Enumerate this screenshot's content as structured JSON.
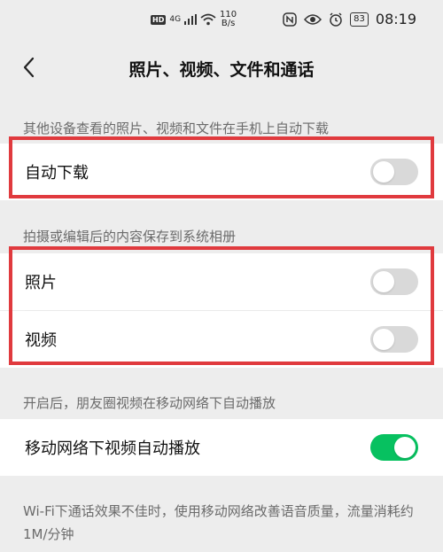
{
  "status_bar": {
    "hd": "HD",
    "network": "4G",
    "speed_value": "110",
    "speed_unit": "B/s",
    "battery": "83",
    "time": "08:19"
  },
  "nav": {
    "title": "照片、视频、文件和通话"
  },
  "sections": {
    "download_header": "其他设备查看的照片、视频和文件在手机上自动下载",
    "auto_download_label": "自动下载",
    "auto_download_on": false,
    "save_header": "拍摄或编辑后的内容保存到系统相册",
    "photo_label": "照片",
    "photo_on": false,
    "video_label": "视频",
    "video_on": false,
    "mobile_header": "开启后，朋友圈视频在移动网络下自动播放",
    "mobile_autoplay_label": "移动网络下视频自动播放",
    "mobile_autoplay_on": true,
    "footer": "Wi-Fi下通话效果不佳时，使用移动网络改善语音质量，流量消耗约1M/分钟"
  },
  "colors": {
    "switch_on": "#07c160",
    "switch_off": "#d9d9d9",
    "highlight": "#e03a3e",
    "background": "#ededed"
  }
}
